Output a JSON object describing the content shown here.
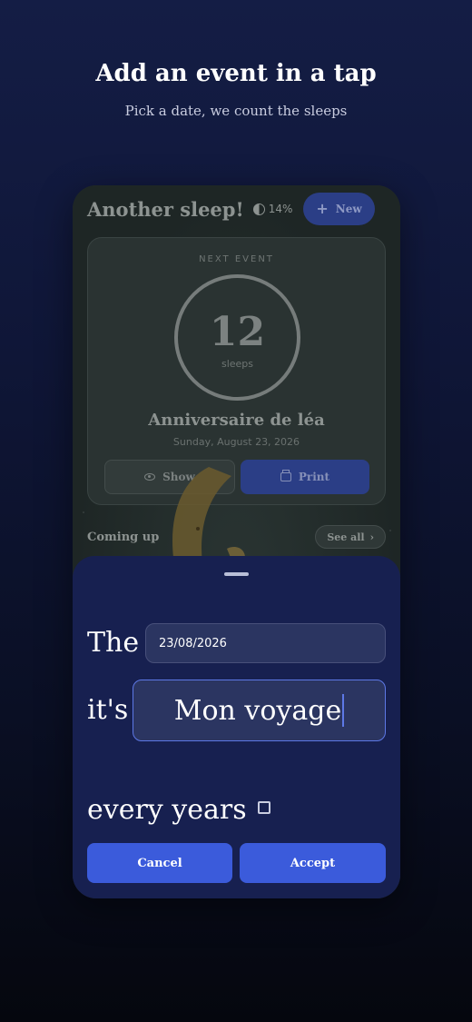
{
  "promo": {
    "title": "Add an event in a tap",
    "subtitle": "Pick a date, we count the sleeps"
  },
  "app": {
    "title": "Another sleep!",
    "progress": "14%",
    "new_label": "New",
    "next_event_label": "NEXT EVENT",
    "count": "12",
    "count_unit": "sleeps",
    "event_name": "Anniversaire de léa",
    "event_date": "Sunday, August 23, 2026",
    "show_label": "Show",
    "print_label": "Print",
    "coming_up": "Coming up",
    "see_all": "See all"
  },
  "sheet": {
    "label_the": "The",
    "date_value": "23/08/2026",
    "label_its": "it's",
    "name_value": "Mon voyage",
    "repeat_label": "every years",
    "repeat_checked": false,
    "cancel_label": "Cancel",
    "accept_label": "Accept"
  },
  "colors": {
    "accent": "#3b5bdb",
    "sheet_bg": "#172050",
    "focus_border": "#5d78e6"
  }
}
